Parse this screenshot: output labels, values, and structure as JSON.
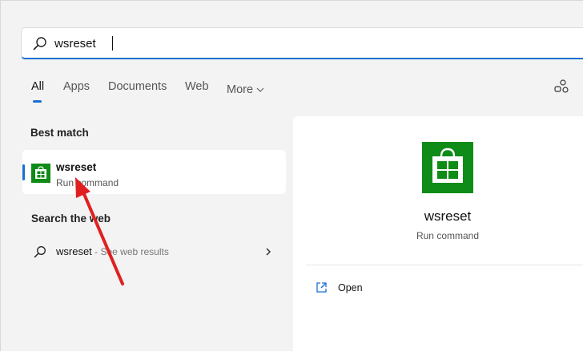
{
  "search": {
    "value": "wsreset",
    "placeholder": ""
  },
  "tabs": [
    {
      "label": "All",
      "active": true
    },
    {
      "label": "Apps",
      "active": false
    },
    {
      "label": "Documents",
      "active": false
    },
    {
      "label": "Web",
      "active": false
    },
    {
      "label": "More",
      "active": false
    }
  ],
  "best_match": {
    "section_label": "Best match",
    "title": "wsreset",
    "subtitle": "Run command",
    "icon": "store-icon"
  },
  "web": {
    "section_label": "Search the web",
    "term": "wsreset",
    "hint": " - See web results"
  },
  "details": {
    "title": "wsreset",
    "subtitle": "Run command",
    "icon": "store-icon",
    "actions": [
      {
        "label": "Open",
        "icon": "open-external-icon"
      }
    ]
  },
  "colors": {
    "accent": "#1a6fd1",
    "store_green": "#0f8b18",
    "annotation_red": "#e02020",
    "panel_bg": "#f3f3f3"
  }
}
